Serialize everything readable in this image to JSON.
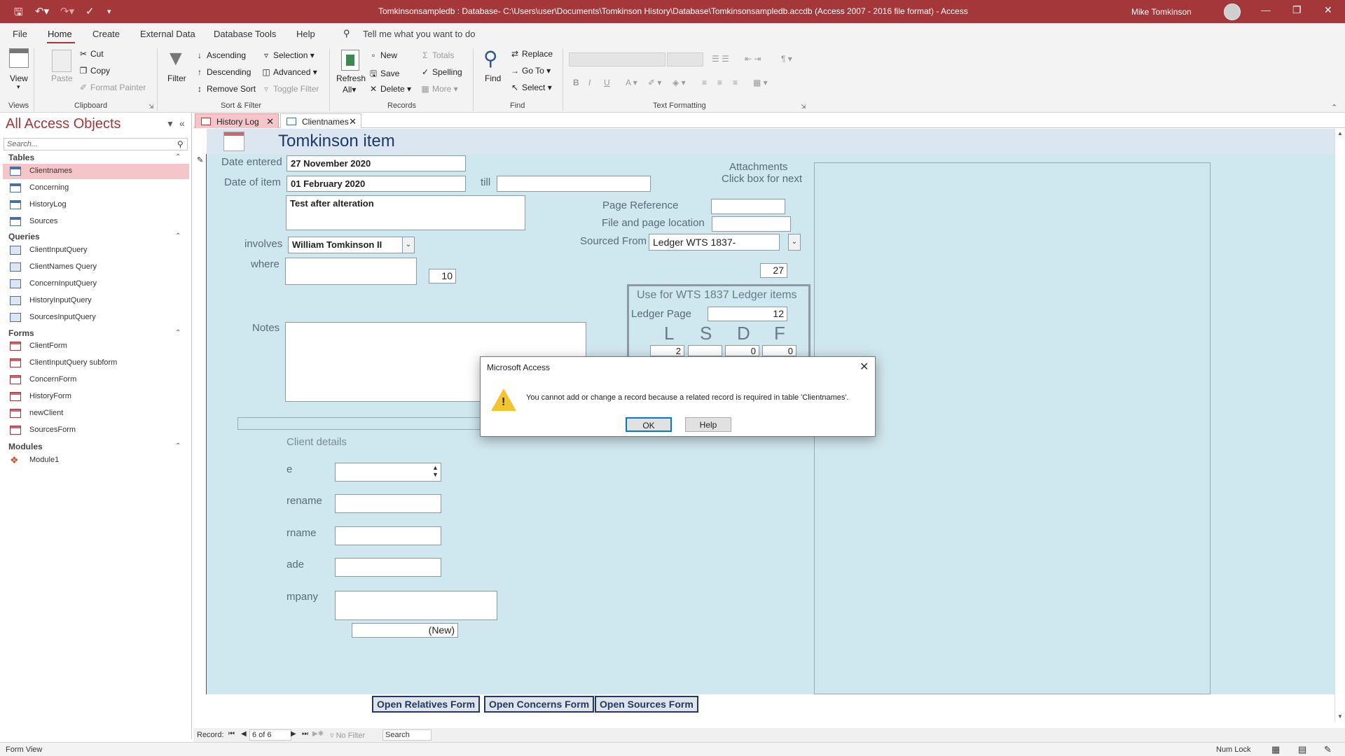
{
  "titlebar": {
    "title": "Tomkinsonsampledb : Database- C:\\Users\\user\\Documents\\Tomkinson History\\Database\\Tomkinsonsampledb.accdb (Access 2007 - 2016 file format) - Access",
    "user": "Mike Tomkinson",
    "icons": [
      "save-icon",
      "undo-icon",
      "redo-icon",
      "spelling-icon",
      "customize-icon",
      "minimize-icon",
      "maximize-icon",
      "close-icon"
    ]
  },
  "ribbon_tabs": [
    "File",
    "Home",
    "Create",
    "External Data",
    "Database Tools",
    "Help"
  ],
  "tell_me": "Tell me what you want to do",
  "ribbon": {
    "views": {
      "view": "View",
      "group": "Views"
    },
    "clipboard": {
      "paste": "Paste",
      "cut": "Cut",
      "copy": "Copy",
      "format_painter": "Format Painter",
      "group": "Clipboard"
    },
    "sort_filter": {
      "filter": "Filter",
      "ascending": "Ascending",
      "descending": "Descending",
      "remove_sort": "Remove Sort",
      "selection": "Selection",
      "advanced": "Advanced",
      "toggle_filter": "Toggle Filter",
      "group": "Sort & Filter"
    },
    "records": {
      "refresh": "Refresh",
      "refresh_all": "All",
      "new": "New",
      "save": "Save",
      "delete": "Delete",
      "totals": "Totals",
      "spelling": "Spelling",
      "more": "More",
      "group": "Records"
    },
    "find": {
      "find": "Find",
      "replace": "Replace",
      "goto": "Go To",
      "select": "Select",
      "group": "Find"
    },
    "text_formatting": {
      "bold": "B",
      "italic": "I",
      "underline": "U",
      "group": "Text Formatting"
    }
  },
  "nav": {
    "title": "All Access Objects",
    "search_placeholder": "Search...",
    "sections": [
      {
        "name": "Tables",
        "items": [
          "Clientnames",
          "Concerning",
          "HistoryLog",
          "Sources"
        ]
      },
      {
        "name": "Queries",
        "items": [
          "ClientInputQuery",
          "ClientNames Query",
          "ConcernInputQuery",
          "HistoryInputQuery",
          "SourcesInputQuery"
        ]
      },
      {
        "name": "Forms",
        "items": [
          "ClientForm",
          "ClientInputQuery subform",
          "ConcernForm",
          "HistoryForm",
          "newClient",
          "SourcesForm"
        ]
      },
      {
        "name": "Modules",
        "items": [
          "Module1"
        ]
      }
    ],
    "selected": "Clientnames"
  },
  "doc_tabs": [
    {
      "label": "History Log",
      "active": true
    },
    {
      "label": "Clientnames",
      "active": false
    }
  ],
  "form": {
    "title": "Tomkinson item",
    "date_entered_label": "Date entered",
    "date_entered": "27 November 2020",
    "date_of_item_label": "Date of item",
    "date_of_item": "01 February 2020",
    "till_label": "till",
    "till": "",
    "description": "Test after alteration",
    "involves_label": "involves",
    "involves": "William Tomkinson II",
    "where_label": "where",
    "where_num": "10",
    "notes_label": "Notes",
    "attachments_label": "Attachments",
    "attachments_hint": "Click box for next",
    "page_reference_label": "Page Reference",
    "file_location_label": "File and page location",
    "sourced_from_label": "Sourced From",
    "sourced_from": "Ledger WTS 1837-",
    "source_num": "27",
    "ledger_title": "Use for WTS 1837 Ledger items",
    "ledger_page_label": "Ledger Page",
    "ledger_page": "12",
    "lsdf": [
      "L",
      "S",
      "D",
      "F"
    ],
    "lsdf_values": [
      "2",
      "",
      "0",
      "0"
    ],
    "client_details_label": "Client details",
    "client_fields": [
      "e",
      "rename",
      "rname",
      "ade",
      "mpany"
    ],
    "client_new": "(New)",
    "buttons": [
      "Open Relatives Form",
      "Open Concerns Form",
      "Open Sources Form"
    ]
  },
  "record_nav": {
    "label": "Record:",
    "position": "6 of 6",
    "filter": "No Filter",
    "search": "Search"
  },
  "status": {
    "left": "Form View",
    "num_lock": "Num Lock"
  },
  "dialog": {
    "title": "Microsoft Access",
    "message": "You cannot add or change a record because a related record is required in table 'Clientnames'.",
    "ok": "OK",
    "help": "Help"
  },
  "colors": {
    "accent": "#a4373a",
    "form_bg": "#cfe7ee",
    "selected_nav": "#f5c6c9"
  }
}
